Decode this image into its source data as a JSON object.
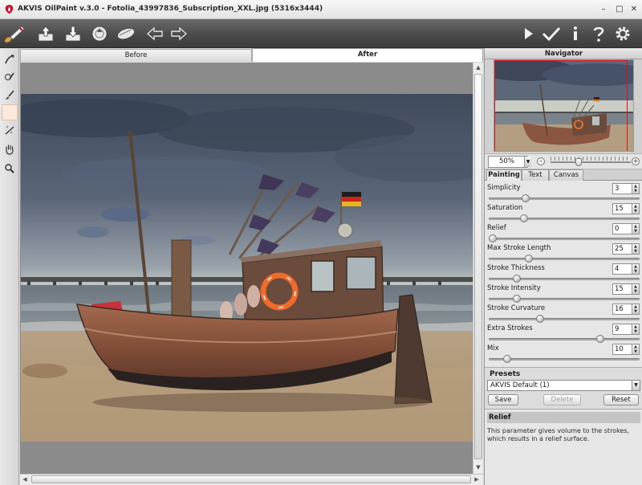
{
  "window": {
    "title": "AKVIS OilPaint v.3.0 - Fotolia_43997836_Subscription_XXL.jpg (5316x3444)",
    "controls": {
      "minimize": "–",
      "maximize": "□",
      "close": "✕"
    }
  },
  "toolbar": {
    "left_icons": [
      "brush-logo-icon",
      "open-icon",
      "save-icon",
      "print-icon",
      "share-icon",
      "undo-icon",
      "redo-icon"
    ],
    "right_icons": [
      "run-icon",
      "apply-icon",
      "info-icon",
      "help-icon",
      "settings-icon"
    ]
  },
  "tools": [
    "direction-tool-icon",
    "stroke-tool-icon",
    "brush-tool-icon",
    "eraser-tool-icon",
    "stamp-tool-icon",
    "hand-tool-icon",
    "zoom-tool-icon"
  ],
  "view_tabs": {
    "before": "Before",
    "after": "After",
    "active": "After"
  },
  "navigator": {
    "title": "Navigator",
    "zoom": "50%"
  },
  "settings_tabs": {
    "painting": "Painting",
    "text": "Text",
    "canvas": "Canvas",
    "active": "Painting"
  },
  "params": [
    {
      "label": "Simplicity",
      "value": "3",
      "level": 0.23
    },
    {
      "label": "Saturation",
      "value": "15",
      "level": 0.22
    },
    {
      "label": "Relief",
      "value": "0",
      "level": 0.0
    },
    {
      "label": "Max Stroke Length",
      "value": "25",
      "level": 0.25
    },
    {
      "label": "Stroke Thickness",
      "value": "4",
      "level": 0.17
    },
    {
      "label": "Stroke Intensity",
      "value": "15",
      "level": 0.17
    },
    {
      "label": "Stroke Curvature",
      "value": "16",
      "level": 0.33
    },
    {
      "label": "Extra Strokes",
      "value": "9",
      "level": 0.75
    },
    {
      "label": "Mix",
      "value": "10",
      "level": 0.1
    }
  ],
  "presets": {
    "title": "Presets",
    "selected": "AKVIS Default (1)",
    "save": "Save",
    "delete": "Delete",
    "reset": "Reset"
  },
  "help": {
    "title": "Relief",
    "text": "This parameter gives volume to the strokes, which results in a relief surface."
  },
  "colors": {
    "toolbar": "#4b4b4b",
    "panel": "#e6e6e6",
    "accent": "#c8102e"
  }
}
